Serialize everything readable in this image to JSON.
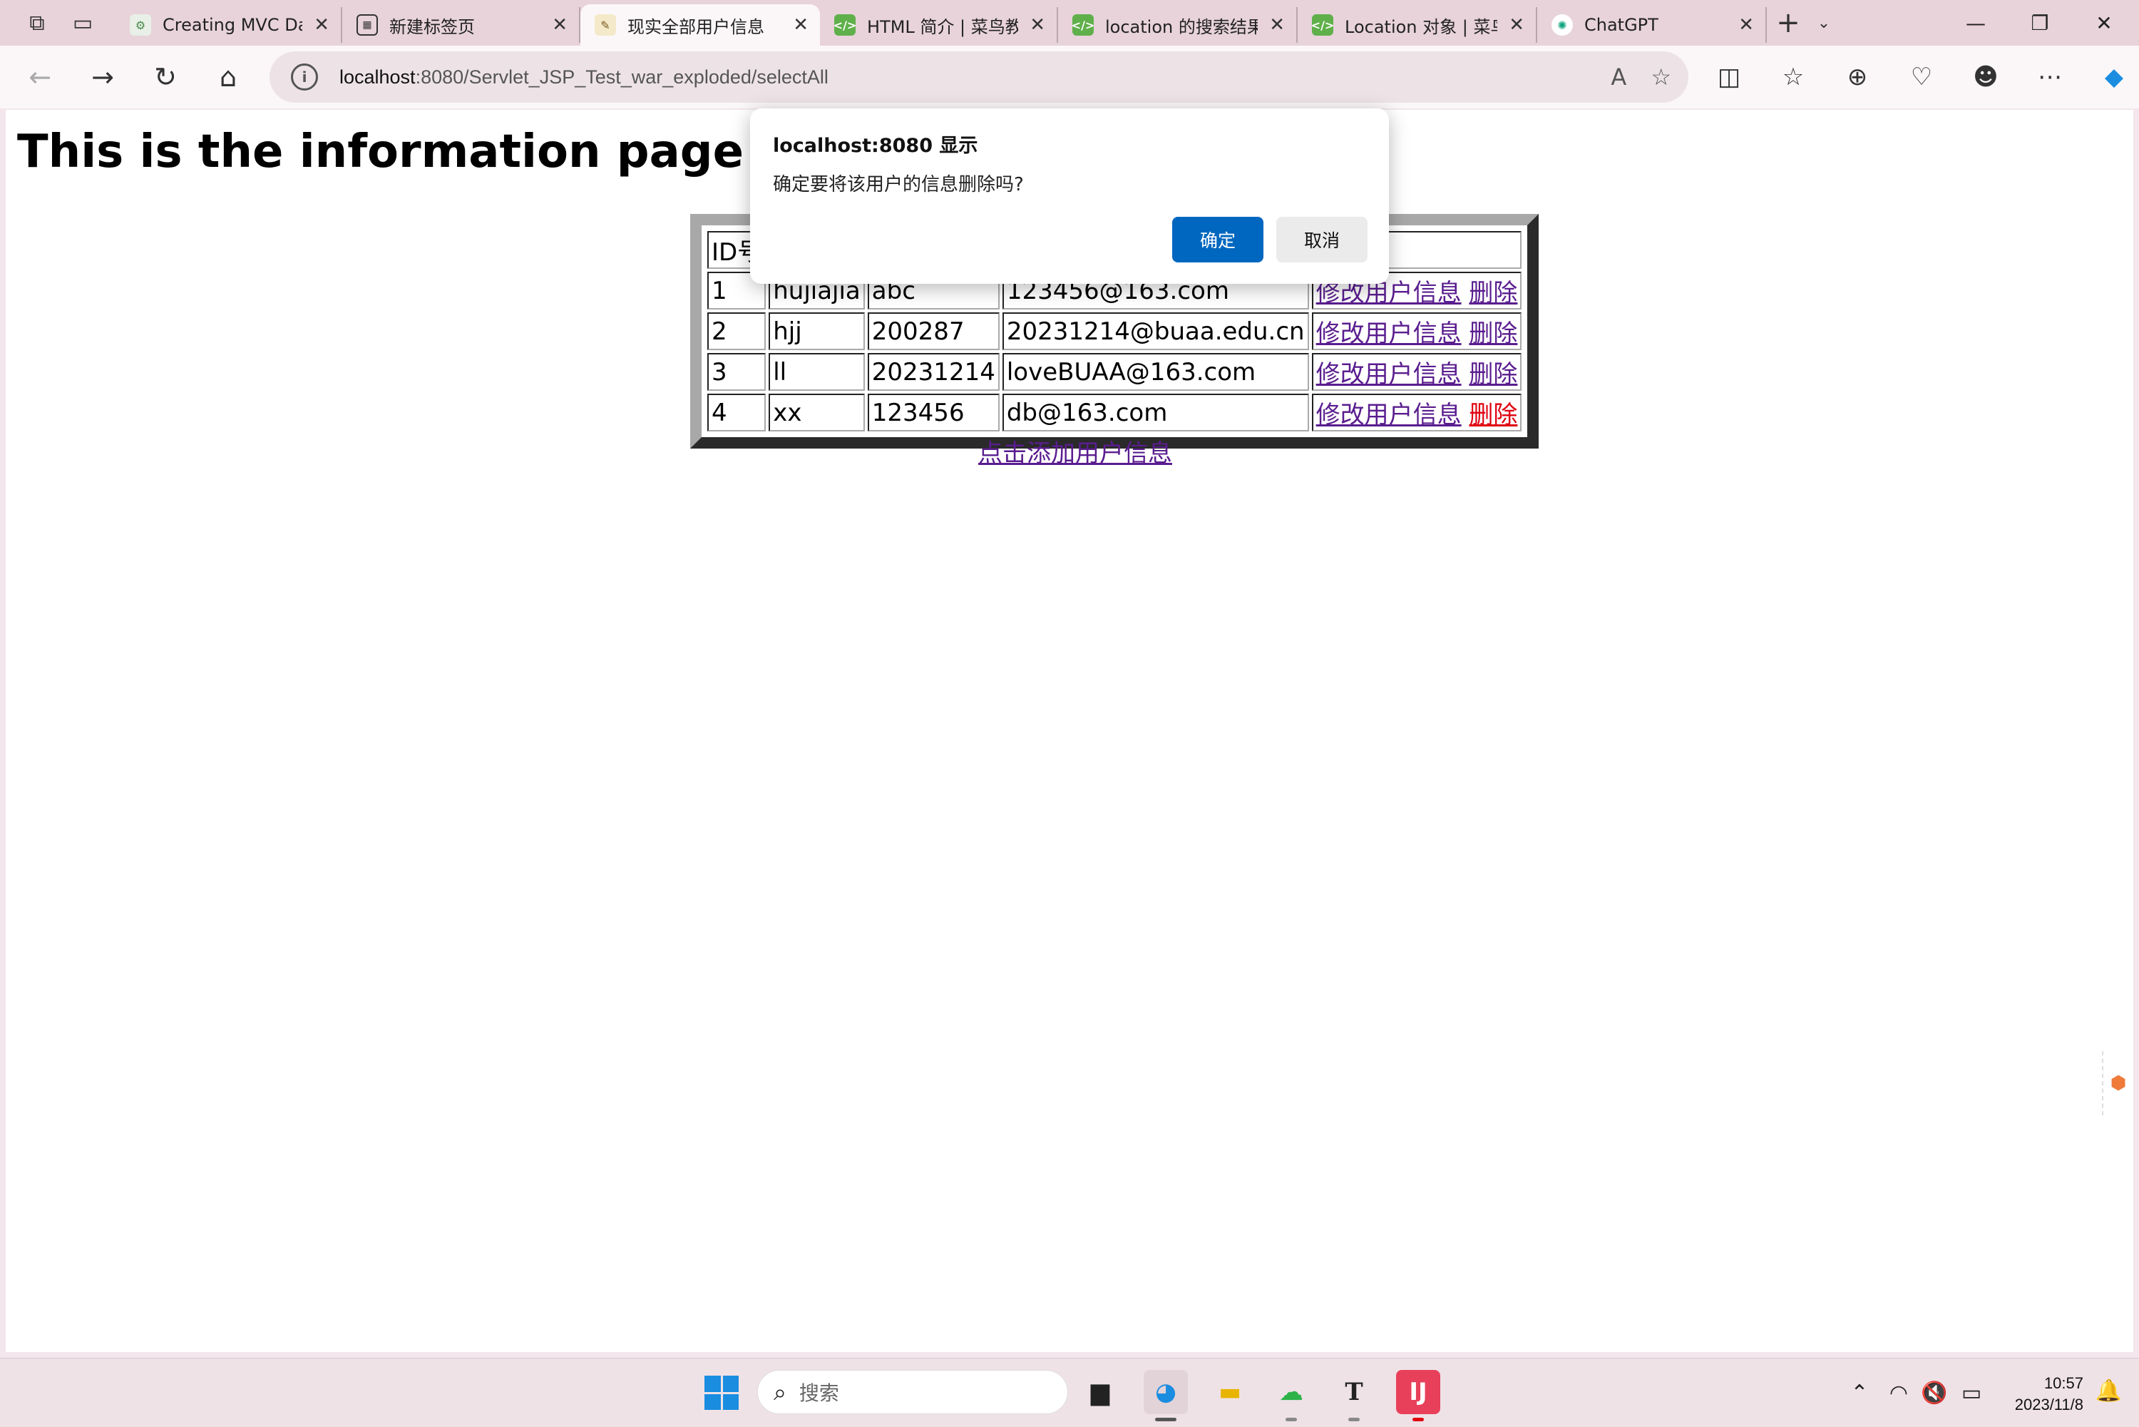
{
  "browser": {
    "tabs": [
      {
        "label": "Creating MVC Data",
        "favicon": "gear-icon",
        "active": false
      },
      {
        "label": "新建标签页",
        "favicon": "newtab-icon",
        "active": false
      },
      {
        "label": "现实全部用户信息",
        "favicon": "page-icon",
        "active": true
      },
      {
        "label": "HTML 简介 | 菜鸟教",
        "favicon": "runoob-icon",
        "active": false
      },
      {
        "label": "location 的搜索结果",
        "favicon": "runoob-icon",
        "active": false
      },
      {
        "label": "Location 对象 | 菜鸟",
        "favicon": "runoob-icon",
        "active": false
      },
      {
        "label": "ChatGPT",
        "favicon": "chatgpt-icon",
        "active": false
      }
    ],
    "address": {
      "host": "localhost",
      "rest": ":8080/Servlet_JSP_Test_war_exploded/selectAll"
    }
  },
  "page": {
    "title": "This is the information page of a",
    "table": {
      "header": [
        "ID号",
        "",
        "",
        "",
        ""
      ],
      "rows": [
        {
          "id": "1",
          "name": "hujiajia",
          "password": "abc",
          "email": "123456@163.com",
          "edit": "修改用户信息",
          "delete": "删除"
        },
        {
          "id": "2",
          "name": "hjj",
          "password": "200287",
          "email": "20231214@buaa.edu.cn",
          "edit": "修改用户信息",
          "delete": "删除"
        },
        {
          "id": "3",
          "name": "ll",
          "password": "20231214",
          "email": "loveBUAA@163.com",
          "edit": "修改用户信息",
          "delete": "删除"
        },
        {
          "id": "4",
          "name": "xx",
          "password": "123456",
          "email": "db@163.com",
          "edit": "修改用户信息",
          "delete": "删除"
        }
      ]
    },
    "add_link": "点击添加用户信息"
  },
  "dialog": {
    "title": "localhost:8080 显示",
    "message": "确定要将该用户的信息删除吗?",
    "ok": "确定",
    "cancel": "取消"
  },
  "taskbar": {
    "search_placeholder": "搜索",
    "time": "10:57",
    "date": "2023/11/8"
  },
  "colors": {
    "link": "#5a1d8f",
    "link_active": "#e0000f",
    "dialog_primary": "#0067c0",
    "titlebar": "#e8d3da"
  }
}
